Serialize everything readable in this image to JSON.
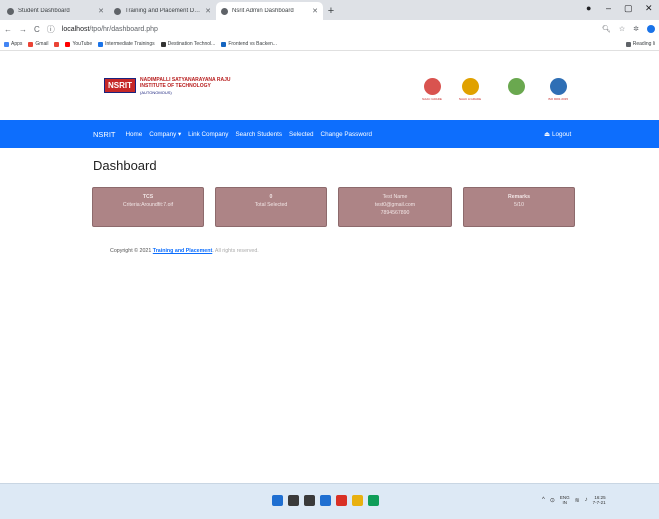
{
  "browser": {
    "tabs": [
      {
        "title": "Student Dashboard",
        "active": false
      },
      {
        "title": "Training and Placement Dashbo",
        "active": false
      },
      {
        "title": "Nsrit Admin Dashboard",
        "active": true
      }
    ],
    "new_tab": "+",
    "window_controls": {
      "minimize": "–",
      "maximize": "▢",
      "close": "✕"
    },
    "address": {
      "host": "localhost",
      "path": "/tpo/hr/dashboard.php"
    },
    "bookmarks": [
      "Apps",
      "Gmail",
      "",
      "YouTube",
      "Intermediate Trainings",
      "Destination Technol...",
      "Frontend vs Backen..."
    ],
    "reading_list": "Reading li"
  },
  "header": {
    "logo_mark": "NSRIT",
    "logo_title": "NADIMPALLI SATYANARAYANA RAJU",
    "logo_subtitle": "INSTITUTE OF TECHNOLOGY",
    "logo_tag": "(AUTONOMOUS)",
    "badges": [
      {
        "color": "#d9534f",
        "caption": "NAAC GRADE"
      },
      {
        "color": "#e0a100",
        "caption": "NAAC A GRADE"
      },
      {
        "color": "#6aa84f",
        "caption": ""
      },
      {
        "color": "#2f6fb5",
        "caption": "ISO 9001:2015"
      }
    ]
  },
  "nav": {
    "brand": "NSRIT",
    "items": [
      "Home",
      "Company ▾",
      "Link Company",
      "Search Students",
      "Selected",
      "Change Password"
    ],
    "logout": "Logout"
  },
  "main": {
    "title": "Dashboard",
    "cards": [
      {
        "line1": "TCS",
        "line2": "Criteria:Aroundfit:7.oif",
        "line3": ""
      },
      {
        "line1": "0",
        "line2": "Total Selected",
        "line3": ""
      },
      {
        "line1": "Test Name",
        "line2": "test0@gmail.com",
        "line3": "7894567890"
      },
      {
        "line1": "Remarks",
        "line2": "5/10",
        "line3": ""
      }
    ]
  },
  "footer": {
    "prefix": "Copyright © 2021",
    "link": "Training and Placement",
    "suffix": "All rights reserved."
  },
  "taskbar": {
    "icons": [
      {
        "name": "start-icon",
        "color": "#1f6fd1"
      },
      {
        "name": "search-icon",
        "color": "#3a3a3a"
      },
      {
        "name": "file-explorer-icon",
        "color": "#3a3a3a"
      },
      {
        "name": "task-view-icon",
        "color": "#1f6fd1"
      },
      {
        "name": "chrome-icon",
        "color": "#d93025"
      },
      {
        "name": "folder-icon",
        "color": "#e8b00f"
      },
      {
        "name": "chrome-icon-2",
        "color": "#0f9d58"
      }
    ],
    "tray": {
      "lang1": "ENG",
      "lang2": "IN",
      "time": "16:25",
      "date": "7-7-21"
    }
  }
}
